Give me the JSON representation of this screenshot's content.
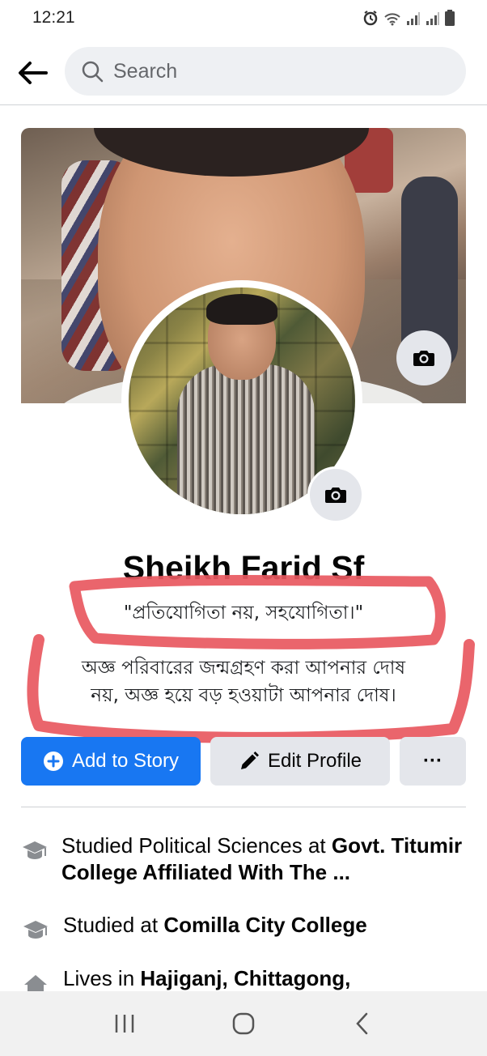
{
  "status_bar": {
    "time": "12:21",
    "icons": [
      "alarm-icon",
      "wifi-icon",
      "signal-icon",
      "signal-icon-2",
      "battery-icon"
    ]
  },
  "header": {
    "back_icon": "arrow-left-icon",
    "search_placeholder": "Search",
    "search_icon": "search-icon"
  },
  "profile": {
    "name": "Sheikh Farid Sf",
    "bio_quote": "\"প্রতিযোগিতা নয়, সহযোগিতা।\"",
    "bio_line1": "অজ্ঞ পরিবারের জন্মগ্রহণ করা আপনার দোষ",
    "bio_line2": "নয়, অজ্ঞ হয়ে বড় হওয়াটা আপনার দোষ।"
  },
  "actions": {
    "add_story": "Add to Story",
    "edit_profile": "Edit Profile",
    "more": "···"
  },
  "details": [
    {
      "icon": "graduation-cap-icon",
      "prefix": "Studied Political Sciences at ",
      "bold": "Govt. Titumir College Affiliated With The ..."
    },
    {
      "icon": "graduation-cap-icon",
      "prefix": "Studied at ",
      "bold": "Comilla City College"
    },
    {
      "icon": "home-icon",
      "prefix": "Lives in ",
      "bold": "Hajiganj, Chittagong,"
    }
  ],
  "colors": {
    "accent": "#1877f2",
    "marker_red": "#e8585f",
    "secondary_button": "#e4e6eb"
  },
  "navbar": {
    "icons": [
      "recent-apps-icon",
      "home-button-icon",
      "back-nav-icon"
    ]
  }
}
